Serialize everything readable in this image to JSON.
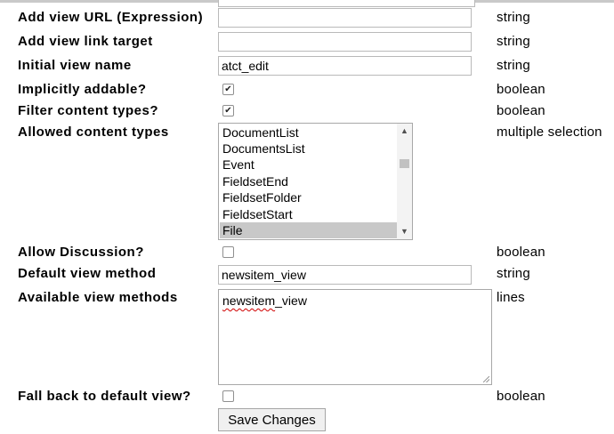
{
  "fields": [
    {
      "label": "Add view URL (Expression)",
      "type": "string",
      "value": ""
    },
    {
      "label": "Add view link target",
      "type": "string",
      "value": ""
    },
    {
      "label": "Initial view name",
      "type": "string",
      "value": "atct_edit"
    },
    {
      "label": "Implicitly addable?",
      "type": "boolean",
      "checked": true
    },
    {
      "label": "Filter content types?",
      "type": "boolean",
      "checked": true
    },
    {
      "label": "Allowed content types",
      "type": "multiple selection"
    },
    {
      "label": "Allow Discussion?",
      "type": "boolean",
      "checked": false
    },
    {
      "label": "Default view method",
      "type": "string",
      "value": "newsitem_view"
    },
    {
      "label": "Available view methods",
      "type": "lines",
      "value_parts": [
        "newsitem",
        "_view"
      ]
    },
    {
      "label": "Fall back to default view?",
      "type": "boolean",
      "checked": false
    }
  ],
  "allowed_types_options": [
    "DocumentList",
    "DocumentsList",
    "Event",
    "FieldsetEnd",
    "FieldsetFolder",
    "FieldsetStart",
    "File"
  ],
  "allowed_types_selected": "File",
  "check_mark": "✔",
  "scroll_up": "▲",
  "scroll_down": "▼",
  "save_button": "Save Changes",
  "colors": {
    "selected_option_bg": "#c8c8c8",
    "spell_underline": "#d00000"
  }
}
